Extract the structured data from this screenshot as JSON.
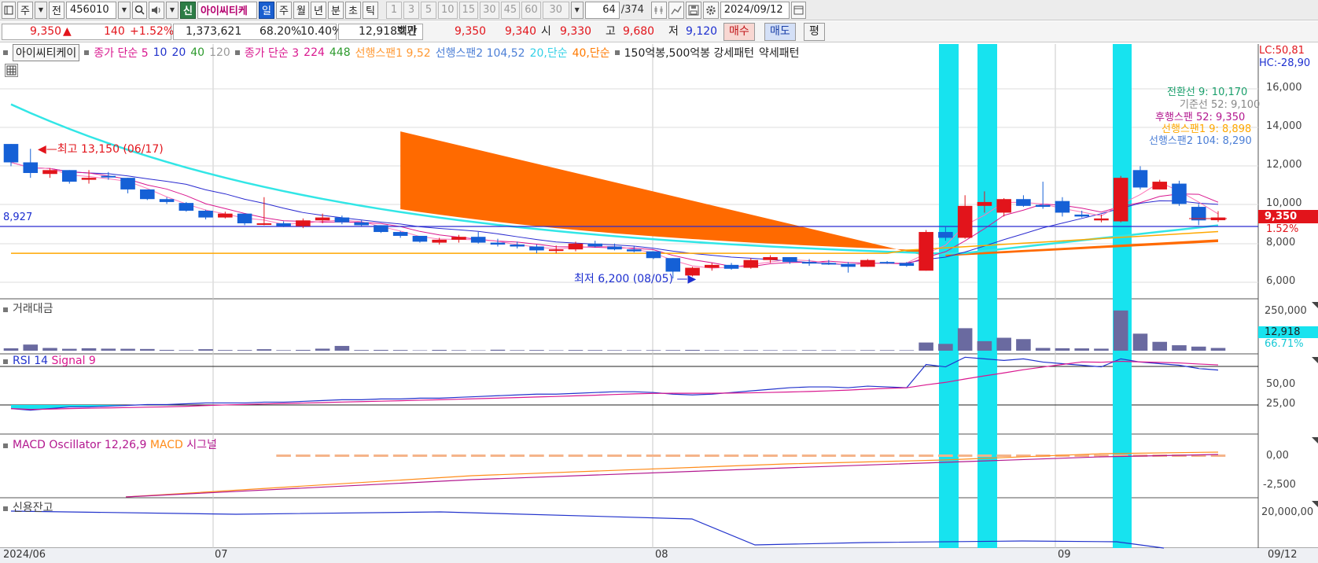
{
  "toolbar": {
    "period_label": "주",
    "prev_label": "전",
    "code": "456010",
    "new_badge": "신",
    "stock_name": "아이씨티케",
    "period_buttons": [
      "일",
      "주",
      "월",
      "년",
      "분",
      "초",
      "틱"
    ],
    "active_period": "일",
    "interval_buttons": [
      "1",
      "3",
      "5",
      "10",
      "15",
      "30",
      "45",
      "60"
    ],
    "interval_select": "30",
    "count": "64",
    "count_total": "/374",
    "date": "2024/09/12"
  },
  "quote": {
    "price": "9,350",
    "arrow": "▲",
    "change": "140",
    "change_pct": "+1.52%",
    "volume": "1,373,621",
    "vol_ratio": "68.20%",
    "turnover": "10.40%",
    "trade_amount": "12,918백만",
    "hoga_label": "호가",
    "ask": "9,350",
    "bid": "9,340",
    "open_label": "시",
    "open": "9,330",
    "high_label": "고",
    "high": "9,680",
    "low_label": "저",
    "low": "9,120",
    "buy_label": "매수",
    "sell_label": "매도",
    "eval_label": "평"
  },
  "legend": {
    "name": "아이씨티케이",
    "ma1_label": "종가 단순 5",
    "ma1_periods": [
      "10",
      "20",
      "40",
      "120"
    ],
    "ma2_label": "종가 단순 3",
    "ma2_periods": [
      "224",
      "448"
    ],
    "span1": "선행스팬1 9,52",
    "span2": "선행스팬2 104,52",
    "ma20": "20,단순",
    "ma40": "40,단순",
    "pattern": "150억봉,500억봉 강세패턴",
    "weak": "약세패턴"
  },
  "right_info": {
    "lc": "LC:50,81",
    "hc": "HC:-28,90",
    "price_tag": "9,350",
    "pct_tag": "1.52%",
    "vol_tag": "12,918",
    "vol_pct": "66.71%"
  },
  "ichimoku": {
    "l1": "전환선 9: 10,170",
    "l2": "기준선 52: 9,100",
    "l3": "후행스팬 52: 9,350",
    "l4": "선행스팬1 9: 8,898",
    "l5": "선행스팬2 104: 8,290"
  },
  "annotations": {
    "high": "최고 13,150 (06/17)",
    "low": "최저 6,200 (08/05)",
    "hline": "8,927"
  },
  "panels": {
    "volume": "거래대금",
    "rsi_a": "RSI 14",
    "rsi_b": "Signal 9",
    "macd_a": "MACD Oscillator 12,26,9",
    "macd_b": "MACD",
    "macd_c": "시그널",
    "credit": "신용잔고"
  },
  "axes": {
    "price_ticks": [
      "16,000",
      "14,000",
      "12,000",
      "10,000",
      "8,000",
      "6,000"
    ],
    "vol_ticks": [
      "250,000"
    ],
    "rsi_ticks": [
      "50,00",
      "25,00"
    ],
    "macd_ticks": [
      "0,00",
      "-2,500"
    ],
    "credit_ticks": [
      "20,000,00"
    ],
    "x_labels": [
      "2024/06",
      "07",
      "08",
      "09",
      "09/12"
    ]
  },
  "colors": {
    "up": "#e2141b",
    "down": "#1560d6",
    "highlight": "#17e3ef",
    "cloud": "#ff6a00",
    "ma20": "#32e6e6",
    "ma40": "#ff8c1a"
  },
  "chart_data": {
    "type": "candlestick",
    "dates_hint": "2024/06 – 2024/09/12",
    "candles": [
      [
        13150,
        13150,
        12000,
        12200
      ],
      [
        12200,
        12900,
        11400,
        11650
      ],
      [
        11600,
        11900,
        11400,
        11800
      ],
      [
        11800,
        11800,
        11100,
        11200
      ],
      [
        11300,
        11800,
        11100,
        11400
      ],
      [
        11500,
        11700,
        11300,
        11450
      ],
      [
        11400,
        11400,
        10600,
        10800
      ],
      [
        10800,
        10800,
        10250,
        10300
      ],
      [
        10300,
        10400,
        10050,
        10150
      ],
      [
        10100,
        10150,
        9650,
        9700
      ],
      [
        9700,
        9750,
        9250,
        9350
      ],
      [
        9350,
        9650,
        9300,
        9550
      ],
      [
        9550,
        9550,
        8950,
        9050
      ],
      [
        9050,
        10400,
        8950,
        9050
      ],
      [
        9050,
        9150,
        8850,
        8900
      ],
      [
        8900,
        9300,
        8800,
        9200
      ],
      [
        9200,
        9550,
        9050,
        9350
      ],
      [
        9350,
        9450,
        9000,
        9100
      ],
      [
        9100,
        9200,
        8900,
        8950
      ],
      [
        8950,
        8950,
        8550,
        8600
      ],
      [
        8600,
        8650,
        8300,
        8400
      ],
      [
        8400,
        8400,
        8050,
        8100
      ],
      [
        8050,
        8300,
        7950,
        8200
      ],
      [
        8200,
        8450,
        8050,
        8350
      ],
      [
        8350,
        8600,
        8000,
        8050
      ],
      [
        8050,
        8250,
        7850,
        7950
      ],
      [
        7950,
        8100,
        7750,
        7850
      ],
      [
        7850,
        7950,
        7500,
        7650
      ],
      [
        7650,
        7900,
        7500,
        7700
      ],
      [
        7700,
        8100,
        7600,
        8000
      ],
      [
        8000,
        8150,
        7800,
        7850
      ],
      [
        7850,
        8000,
        7650,
        7700
      ],
      [
        7700,
        7850,
        7550,
        7600
      ],
      [
        7600,
        7600,
        7200,
        7250
      ],
      [
        7250,
        7250,
        6200,
        6550
      ],
      [
        6350,
        6800,
        6300,
        6750
      ],
      [
        6750,
        7000,
        6600,
        6900
      ],
      [
        6900,
        7000,
        6650,
        6700
      ],
      [
        6750,
        7250,
        6700,
        7150
      ],
      [
        7150,
        7400,
        7000,
        7300
      ],
      [
        7300,
        7300,
        6950,
        7050
      ],
      [
        7050,
        7200,
        6850,
        7000
      ],
      [
        7000,
        7150,
        6900,
        6950
      ],
      [
        6950,
        7050,
        6500,
        6800
      ],
      [
        6800,
        7200,
        6800,
        7150
      ],
      [
        7050,
        7100,
        6950,
        7000
      ],
      [
        7000,
        7050,
        6800,
        6850
      ],
      [
        6600,
        8700,
        6600,
        8600
      ],
      [
        8600,
        8900,
        8150,
        8300
      ],
      [
        8300,
        10500,
        8250,
        9950
      ],
      [
        9950,
        10700,
        9600,
        10150
      ],
      [
        9600,
        10350,
        9400,
        10300
      ],
      [
        10300,
        10500,
        9900,
        9950
      ],
      [
        10000,
        11200,
        9800,
        9900
      ],
      [
        10200,
        10400,
        9400,
        9600
      ],
      [
        9500,
        9700,
        9350,
        9400
      ],
      [
        9200,
        9500,
        9100,
        9300
      ],
      [
        9150,
        11500,
        9100,
        11400
      ],
      [
        11800,
        12000,
        10800,
        10900
      ],
      [
        10800,
        11300,
        10800,
        11200
      ],
      [
        11100,
        11250,
        9950,
        10050
      ],
      [
        9900,
        10050,
        8950,
        9200
      ],
      [
        9210,
        9680,
        9120,
        9350
      ]
    ],
    "volume_amount": [
      35,
      90,
      40,
      28,
      36,
      30,
      28,
      25,
      12,
      8,
      22,
      10,
      10,
      22,
      8,
      12,
      30,
      70,
      10,
      12,
      10,
      6,
      12,
      8,
      5,
      14,
      8,
      10,
      6,
      10,
      9,
      8,
      7,
      8,
      9,
      12,
      8,
      6,
      8,
      7,
      6,
      8,
      7,
      5,
      8,
      8,
      7,
      120,
      100,
      330,
      140,
      190,
      170,
      40,
      36,
      34,
      30,
      590,
      250,
      130,
      80,
      60,
      40
    ],
    "rsi": [
      20,
      18,
      20,
      22,
      22,
      23,
      24,
      25,
      25,
      26,
      27,
      27,
      27,
      28,
      28,
      29,
      30,
      31,
      31,
      32,
      32,
      33,
      33,
      34,
      35,
      36,
      37,
      38,
      38,
      39,
      40,
      41,
      41,
      40,
      38,
      37,
      38,
      40,
      42,
      44,
      46,
      47,
      47,
      46,
      48,
      47,
      46,
      75,
      72,
      84,
      82,
      80,
      82,
      78,
      76,
      74,
      72,
      82,
      78,
      76,
      74,
      70,
      68
    ]
  }
}
